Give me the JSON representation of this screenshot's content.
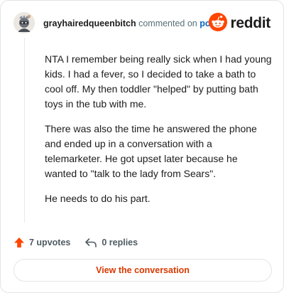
{
  "header": {
    "username": "grayhairedqueenbitch",
    "action_text": "commented on",
    "post_link": "post",
    "brand_name": "reddit"
  },
  "comment": {
    "paragraphs": [
      "NTA I remember being really sick when I had young kids. I had a fever, so I decided to take a bath to cool off. My then toddler \"helped\" by putting bath toys in the tub with me.",
      "There was also the time he answered the phone and ended up in a conversation with a telemarketer. He got upset later because he wanted to \"talk to the lady from Sears\".",
      "He needs to do his part."
    ]
  },
  "stats": {
    "upvotes": "7 upvotes",
    "replies": "0 replies"
  },
  "cta": {
    "view_label": "View the conversation"
  },
  "icons": {
    "brand_logo": "reddit-snoo-icon",
    "upvote": "upvote-arrow-icon",
    "reply": "reply-arrow-icon",
    "avatar": "user-avatar"
  },
  "colors": {
    "brand_orange": "#ff4500",
    "upvote_orange": "#ff4500",
    "cta_text": "#d93900",
    "post_link": "#0a66c2"
  }
}
